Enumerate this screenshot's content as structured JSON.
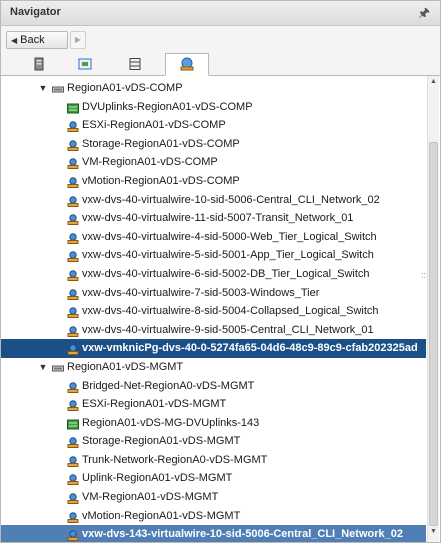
{
  "header": {
    "title": "Navigator",
    "pin_icon": "pin-icon"
  },
  "nav": {
    "back_label": "Back"
  },
  "tabs": [
    {
      "name": "hosts-clusters",
      "icon": "hosts-icon"
    },
    {
      "name": "vms-templates",
      "icon": "vms-icon"
    },
    {
      "name": "storage",
      "icon": "storage-icon"
    },
    {
      "name": "networking",
      "icon": "network-icon",
      "active": true
    }
  ],
  "tree": [
    {
      "label": "RegionA01-vDS-COMP",
      "level": 0,
      "kind": "switch",
      "expanded": true
    },
    {
      "label": "DVUplinks-RegionA01-vDS-COMP",
      "level": 1,
      "kind": "uplink"
    },
    {
      "label": "ESXi-RegionA01-vDS-COMP",
      "level": 1,
      "kind": "portgroup"
    },
    {
      "label": "Storage-RegionA01-vDS-COMP",
      "level": 1,
      "kind": "portgroup"
    },
    {
      "label": "VM-RegionA01-vDS-COMP",
      "level": 1,
      "kind": "portgroup"
    },
    {
      "label": "vMotion-RegionA01-vDS-COMP",
      "level": 1,
      "kind": "portgroup"
    },
    {
      "label": "vxw-dvs-40-virtualwire-10-sid-5006-Central_CLI_Network_02",
      "level": 1,
      "kind": "portgroup"
    },
    {
      "label": "vxw-dvs-40-virtualwire-11-sid-5007-Transit_Network_01",
      "level": 1,
      "kind": "portgroup"
    },
    {
      "label": "vxw-dvs-40-virtualwire-4-sid-5000-Web_Tier_Logical_Switch",
      "level": 1,
      "kind": "portgroup"
    },
    {
      "label": "vxw-dvs-40-virtualwire-5-sid-5001-App_Tier_Logical_Switch",
      "level": 1,
      "kind": "portgroup"
    },
    {
      "label": "vxw-dvs-40-virtualwire-6-sid-5002-DB_Tier_Logical_Switch",
      "level": 1,
      "kind": "portgroup"
    },
    {
      "label": "vxw-dvs-40-virtualwire-7-sid-5003-Windows_Tier",
      "level": 1,
      "kind": "portgroup"
    },
    {
      "label": "vxw-dvs-40-virtualwire-8-sid-5004-Collapsed_Logical_Switch",
      "level": 1,
      "kind": "portgroup"
    },
    {
      "label": "vxw-dvs-40-virtualwire-9-sid-5005-Central_CLI_Network_01",
      "level": 1,
      "kind": "portgroup"
    },
    {
      "label": "vxw-vmknicPg-dvs-40-0-5274fa65-04d6-48c9-89c9-cfab202325ad",
      "level": 1,
      "kind": "portgroup",
      "selected": "primary"
    },
    {
      "label": "RegionA01-vDS-MGMT",
      "level": 0,
      "kind": "switch",
      "expanded": true
    },
    {
      "label": "Bridged-Net-RegionA0-vDS-MGMT",
      "level": 1,
      "kind": "portgroup"
    },
    {
      "label": "ESXi-RegionA01-vDS-MGMT",
      "level": 1,
      "kind": "portgroup"
    },
    {
      "label": "RegionA01-vDS-MG-DVUplinks-143",
      "level": 1,
      "kind": "uplink"
    },
    {
      "label": "Storage-RegionA01-vDS-MGMT",
      "level": 1,
      "kind": "portgroup"
    },
    {
      "label": "Trunk-Network-RegionA0-vDS-MGMT",
      "level": 1,
      "kind": "portgroup"
    },
    {
      "label": "Uplink-RegionA01-vDS-MGMT",
      "level": 1,
      "kind": "portgroup"
    },
    {
      "label": "VM-RegionA01-vDS-MGMT",
      "level": 1,
      "kind": "portgroup"
    },
    {
      "label": "vMotion-RegionA01-vDS-MGMT",
      "level": 1,
      "kind": "portgroup"
    },
    {
      "label": "vxw-dvs-143-virtualwire-10-sid-5006-Central_CLI_Network_02",
      "level": 1,
      "kind": "portgroup",
      "selected": "secondary"
    }
  ]
}
